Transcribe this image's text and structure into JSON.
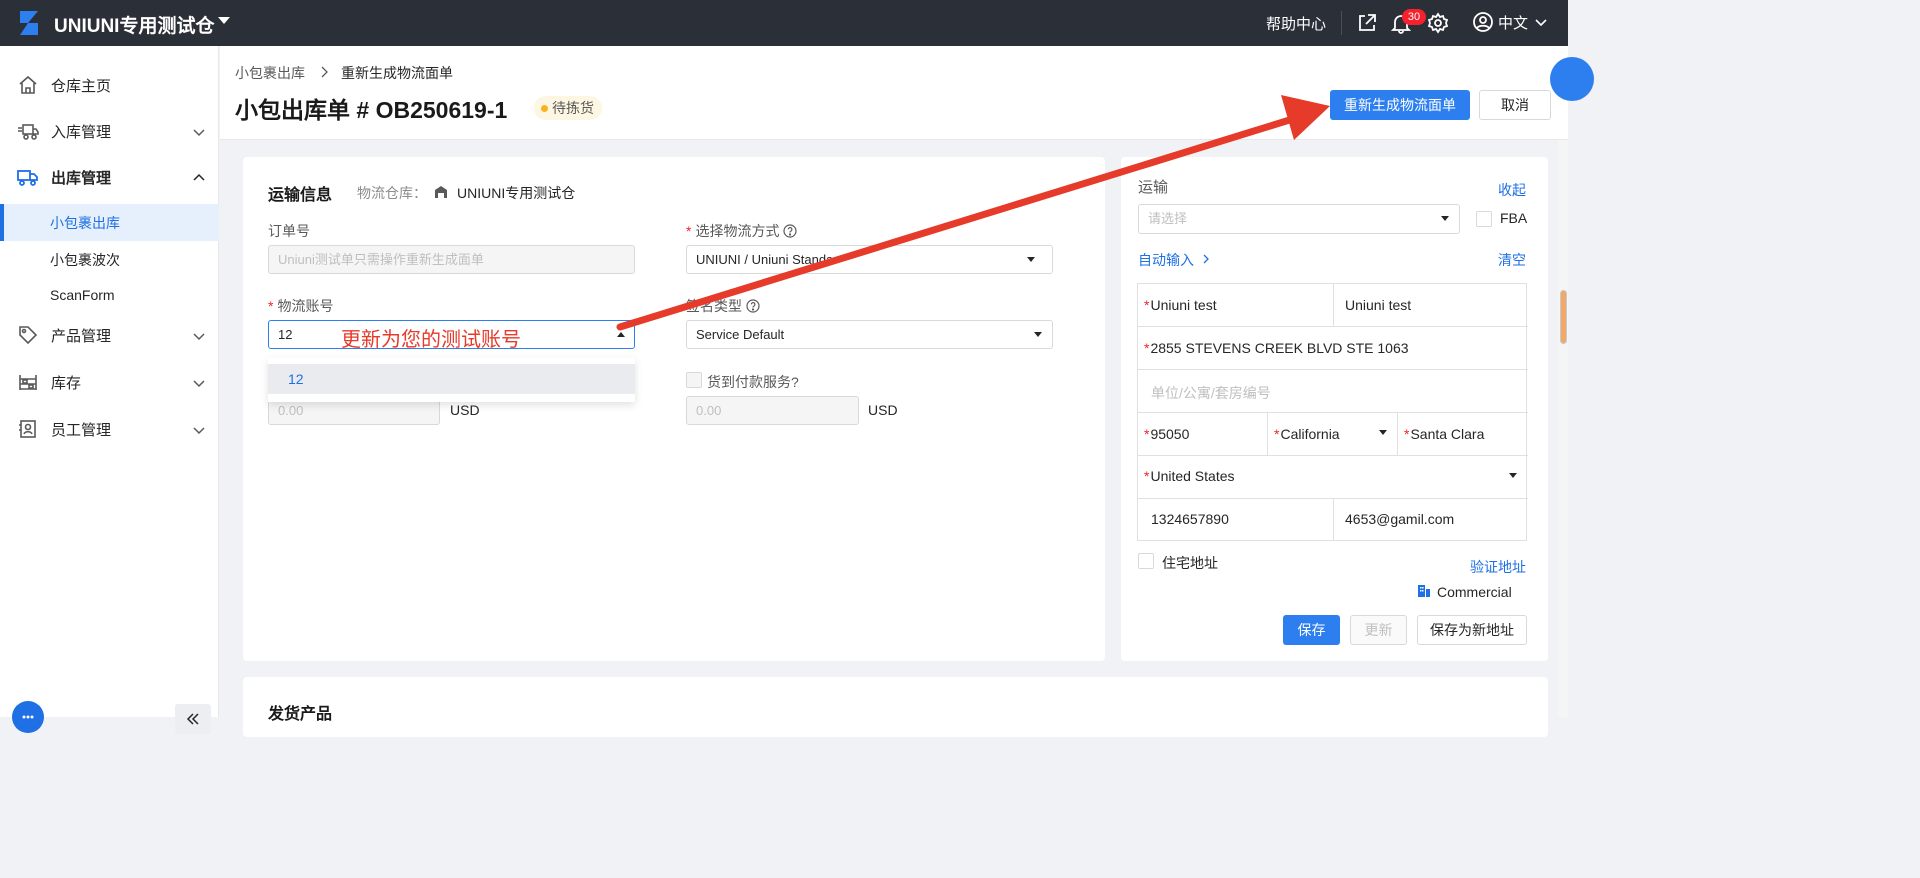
{
  "topbar": {
    "brand": "UNIUNI专用测试仓",
    "help": "帮助中心",
    "notification_count": "30",
    "language": "中文",
    "icons": [
      "logo-icon",
      "caret-down-icon",
      "export-icon",
      "bell-icon",
      "gear-icon",
      "user-icon",
      "chevron-down-icon"
    ]
  },
  "sidebar": {
    "items": [
      {
        "label": "仓库主页",
        "icon": "home-icon"
      },
      {
        "label": "入库管理",
        "icon": "truck-in-icon"
      },
      {
        "label": "出库管理",
        "icon": "truck-out-icon"
      },
      {
        "label": "产品管理",
        "icon": "tag-icon"
      },
      {
        "label": "库存",
        "icon": "warehouse-icon"
      },
      {
        "label": "员工管理",
        "icon": "staff-icon"
      }
    ],
    "sub_items": [
      {
        "label": "小包裹出库",
        "active": true
      },
      {
        "label": "小包裹波次",
        "active": false
      },
      {
        "label": "ScanForm",
        "active": false
      }
    ]
  },
  "header": {
    "breadcrumb": [
      "小包裹出库",
      "重新生成物流面单"
    ],
    "title": "小包出库单 # OB250619-1",
    "status": "待拣货",
    "primary_button": "重新生成物流面单",
    "cancel_button": "取消"
  },
  "shipping": {
    "section_title": "运输信息",
    "warehouse_label": "物流仓库：",
    "warehouse_value": "UNIUNI专用测试仓",
    "order_no_label": "订单号",
    "order_no_placeholder": "Uniuni测试单只需操作重新生成面单",
    "method_label": "选择物流方式",
    "method_value": "UNIUNI / Uniuni Standa",
    "account_label": "物流账号",
    "account_value": "12",
    "account_options": [
      "12"
    ],
    "signature_label": "签名类型",
    "signature_value": "Service Default",
    "insurance_value": "0.00",
    "insurance_currency": "USD",
    "cod_label": "货到付款服务?",
    "cod_value": "0.00",
    "cod_currency": "USD",
    "annotation": "更新为您的测试账号"
  },
  "address_panel": {
    "transport_label": "运输",
    "collapse_link": "收起",
    "select_placeholder": "请选择",
    "fba_label": "FBA",
    "auto_input": "自动输入",
    "clear_link": "清空",
    "first_name": "Uniuni test",
    "last_name": "Uniuni test",
    "street": "2855 STEVENS CREEK BLVD STE 1063",
    "unit_placeholder": "单位/公寓/套房编号",
    "zip": "95050",
    "state": "California",
    "city": "Santa Clara",
    "country": "United States",
    "phone": "1324657890",
    "email": "4653@gamil.com",
    "residential_label": "住宅地址",
    "verify_link": "验证地址",
    "address_type": "Commercial",
    "save_button": "保存",
    "update_button": "更新",
    "save_new_button": "保存为新地址"
  },
  "products": {
    "section_title": "发货产品"
  },
  "colors": {
    "topbar": "#2b2f38",
    "primary": "#2d7ff0",
    "annotation_red": "#e63a2a",
    "status_dot": "#fab21c"
  }
}
